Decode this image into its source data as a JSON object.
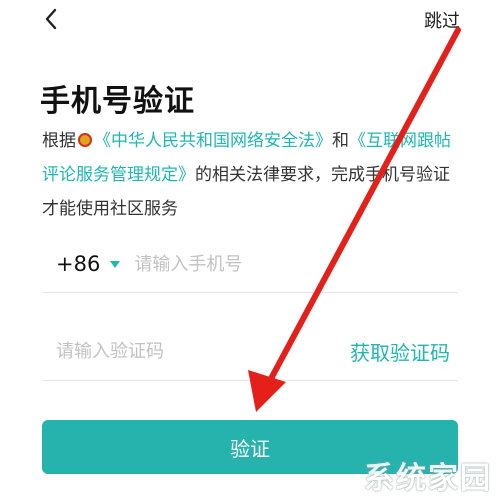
{
  "header": {
    "back_icon": "chevron-left-icon",
    "skip_label": "跳过"
  },
  "title": "手机号验证",
  "description": {
    "prefix": "根据",
    "law1": "《中华人民共和国网络安全法》",
    "conj": "和",
    "law2": "《互联网跟帖评论服务管理规定》",
    "suffix": "的相关法律要求，完成手机号验证才能使用社区服务"
  },
  "phone": {
    "country_code": "+86",
    "placeholder": "请输入手机号",
    "value": ""
  },
  "code": {
    "placeholder": "请输入验证码",
    "value": "",
    "get_code_label": "获取验证码"
  },
  "verify_label": "验证",
  "watermark": "系统家园",
  "colors": {
    "accent": "#1fb8b0",
    "button": "#26b3ad",
    "annotation_arrow": "#e5201a"
  }
}
